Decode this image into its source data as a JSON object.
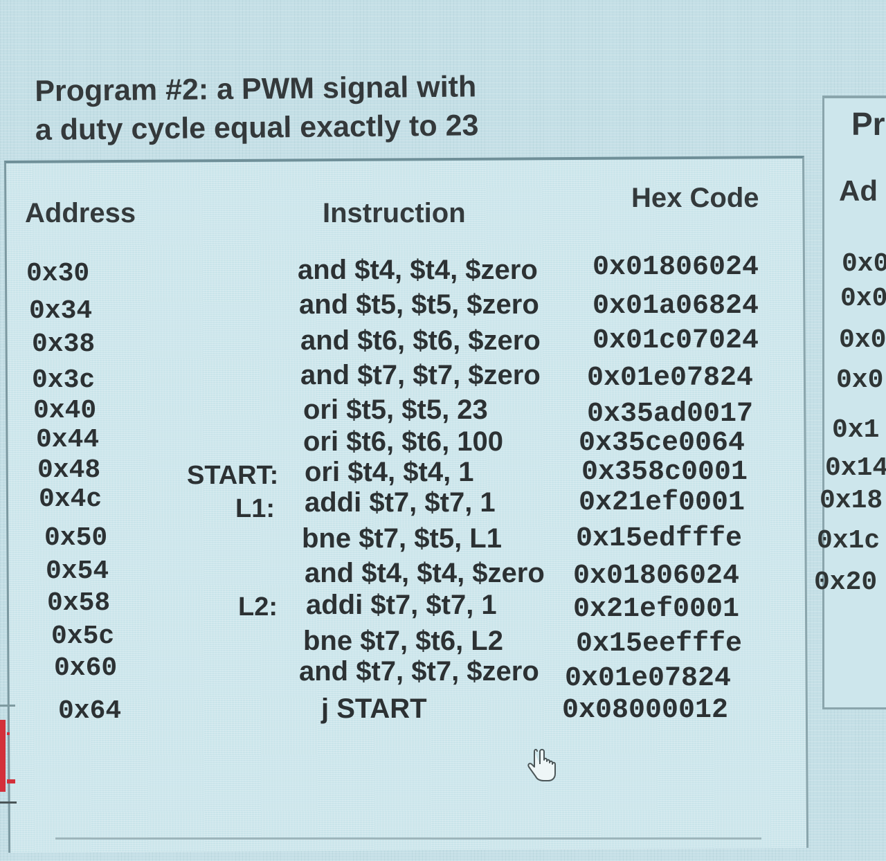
{
  "title": {
    "line1": "Program #2: a PWM signal with",
    "line2": "a duty cycle equal exactly to 23"
  },
  "headers": {
    "address": "Address",
    "instruction": "Instruction",
    "hex": "Hex Code"
  },
  "rows": [
    {
      "address": "0x30",
      "label": "",
      "instruction": "and $t4, $t4, $zero",
      "hex": "0x01806024"
    },
    {
      "address": "0x34",
      "label": "",
      "instruction": "and $t5, $t5, $zero",
      "hex": "0x01a06824"
    },
    {
      "address": "0x38",
      "label": "",
      "instruction": "and $t6, $t6, $zero",
      "hex": "0x01c07024"
    },
    {
      "address": "0x3c",
      "label": "",
      "instruction": "and $t7, $t7, $zero",
      "hex": "0x01e07824"
    },
    {
      "address": "0x40",
      "label": "",
      "instruction": "ori $t5, $t5, 23",
      "hex": "0x35ad0017"
    },
    {
      "address": "0x44",
      "label": "",
      "instruction": "ori $t6, $t6, 100",
      "hex": "0x35ce0064"
    },
    {
      "address": "0x48",
      "label": "START:",
      "instruction": "ori $t4, $t4, 1",
      "hex": "0x358c0001"
    },
    {
      "address": "0x4c",
      "label": "L1:",
      "instruction": "addi $t7, $t7, 1",
      "hex": "0x21ef0001"
    },
    {
      "address": "0x50",
      "label": "",
      "instruction": "bne $t7, $t5, L1",
      "hex": "0x15edfffe"
    },
    {
      "address": "0x54",
      "label": "",
      "instruction": "and $t4, $t4, $zero",
      "hex": "0x01806024"
    },
    {
      "address": "0x58",
      "label": "L2:",
      "instruction": "addi $t7, $t7, 1",
      "hex": "0x21ef0001"
    },
    {
      "address": "0x5c",
      "label": "",
      "instruction": "bne $t7, $t6, L2",
      "hex": "0x15eefffe"
    },
    {
      "address": "0x60",
      "label": "",
      "instruction": "and $t7, $t7, $zero",
      "hex": "0x01e07824"
    },
    {
      "address": "0x64",
      "label": "",
      "instruction": "j START",
      "hex": "0x08000012"
    }
  ],
  "right_panel": {
    "title": "Pr",
    "header": "Ad",
    "addresses": [
      "0x0",
      "0x0",
      "0x0",
      "0x0",
      "0x1",
      "0x14",
      "0x18",
      "0x1c",
      "0x20"
    ]
  },
  "icons": {
    "cursor": "hand-pointer-icon"
  }
}
